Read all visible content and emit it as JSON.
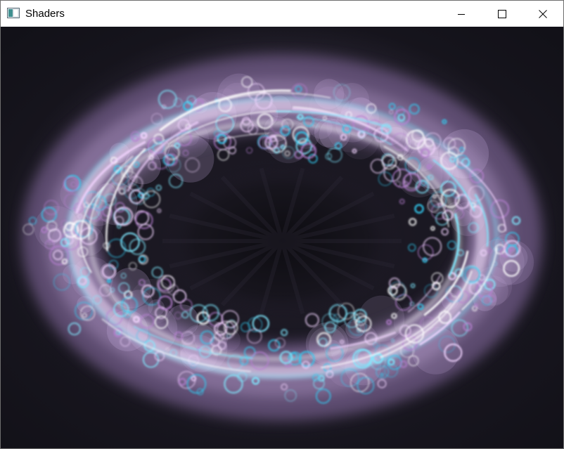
{
  "window": {
    "title": "Shaders",
    "icon": "app-window-icon"
  },
  "caption_buttons": {
    "minimize_icon": "minimize-icon",
    "maximize_icon": "maximize-icon",
    "close_icon": "close-icon"
  },
  "canvas": {
    "description_icon": "shader-render-canvas",
    "background_color": "#14121a",
    "glow_colors": [
      "#ffffff",
      "#f2d4ff",
      "#7fe9ff",
      "#31c9ef",
      "#b77fd1"
    ]
  }
}
